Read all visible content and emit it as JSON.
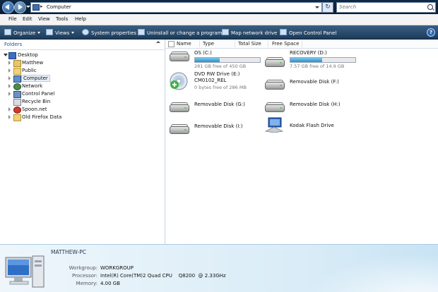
{
  "address": {
    "path": "Computer",
    "search_placeholder": "Search"
  },
  "menu": [
    "File",
    "Edit",
    "View",
    "Tools",
    "Help"
  ],
  "toolbar": {
    "organize": "Organize",
    "views": "Views",
    "system_properties": "System properties",
    "uninstall": "Uninstall or change a program",
    "map_drive": "Map network drive",
    "control_panel": "Open Control Panel"
  },
  "nav": {
    "header": "Folders",
    "items": [
      {
        "label": "Desktop",
        "icon": "desktop-icon"
      },
      {
        "label": "Matthew",
        "icon": "user-folder-icon"
      },
      {
        "label": "Public",
        "icon": "folder-icon"
      },
      {
        "label": "Computer",
        "icon": "computer-icon"
      },
      {
        "label": "Network",
        "icon": "network-icon"
      },
      {
        "label": "Control Panel",
        "icon": "control-panel-icon"
      },
      {
        "label": "Recycle Bin",
        "icon": "recycle-bin-icon"
      },
      {
        "label": "Spoon.net",
        "icon": "spoon-icon"
      },
      {
        "label": "Old Firefox Data",
        "icon": "folder-icon"
      }
    ]
  },
  "columns": [
    "Name",
    "Type",
    "Total Size",
    "Free Space"
  ],
  "items": [
    {
      "name": "OS (C:)",
      "free_text": "281 GB free of 450 GB",
      "used_fraction": 0.38
    },
    {
      "name": "RECOVERY (D:)",
      "free_text": "7.57 GB free of 14.9 GB",
      "used_fraction": 0.49
    },
    {
      "name": "DVD RW Drive (E:)",
      "name2": "CM0102_REL",
      "free_text": "0 bytes free of 286 MB"
    },
    {
      "name": "Removable Disk (F:)"
    },
    {
      "name": "Removable Disk (G:)"
    },
    {
      "name": "Removable Disk (H:)"
    },
    {
      "name": "Removable Disk (I:)"
    },
    {
      "name": "Kodak Flash Drive"
    }
  ],
  "details": {
    "computer_name": "MATTHEW-PC",
    "workgroup_label": "Workgroup:",
    "workgroup": "WORKGROUP",
    "processor_label": "Processor:",
    "processor": "Intel(R) Core(TM)2 Quad CPU    Q8200  @ 2.33GHz",
    "memory_label": "Memory:",
    "memory": "4.00 GB"
  }
}
